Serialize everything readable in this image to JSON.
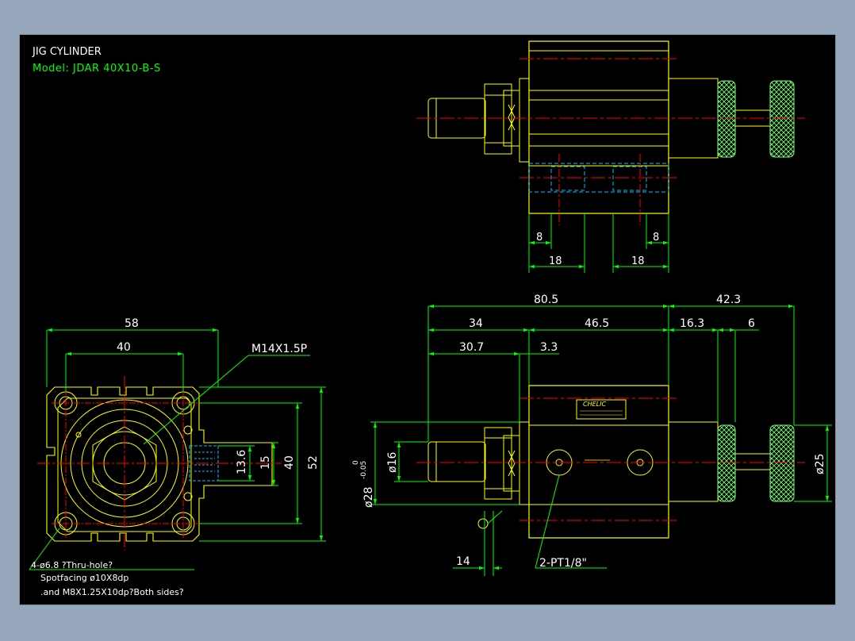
{
  "title": {
    "line1": "JIG CYLINDER",
    "line2": "Model:  JDAR 40X10-B-S"
  },
  "colors": {
    "frame_bg": "#98a8bc",
    "canvas_bg": "#000000",
    "outline": "#ffff00",
    "dimension": "#00ff00",
    "centerline": "#ff0000",
    "hidden": "#00c0ff",
    "knurl": "#7aff7a",
    "text_white": "#ffffff"
  },
  "top_view": {
    "dims": {
      "left_inner": "8",
      "right_inner": "8",
      "left_outer": "18",
      "right_outer": "18"
    }
  },
  "side_view": {
    "dims": {
      "overall": "80.5",
      "rod_extension": "42.3",
      "front_part": "34",
      "body_length": "46.5",
      "rod_to_knob": "16.3",
      "knob_gap": "6",
      "rod_length": "30.7",
      "flange": "3.3",
      "bore_dia_prefix": "ø28",
      "tol_upper": "0",
      "tol_lower": "-0.05",
      "rod_dia": "ø16",
      "knob_dia": "ø25",
      "nut_offset": "14"
    },
    "port_label": "2-PT1/8\"",
    "brand_label": "CHELIC"
  },
  "front_view": {
    "dims": {
      "width": "58",
      "hole_pitch_x": "40",
      "inner": "13.6",
      "inner2": "15",
      "pitch_y": "40",
      "height": "52"
    },
    "thread_label": "M14X1.5P",
    "notes": [
      "4-ø6.8 ?Thru-hole?",
      "Spotfacing  ø10X8dp",
      ".and M8X1.25X10dp?Both sides?"
    ]
  }
}
